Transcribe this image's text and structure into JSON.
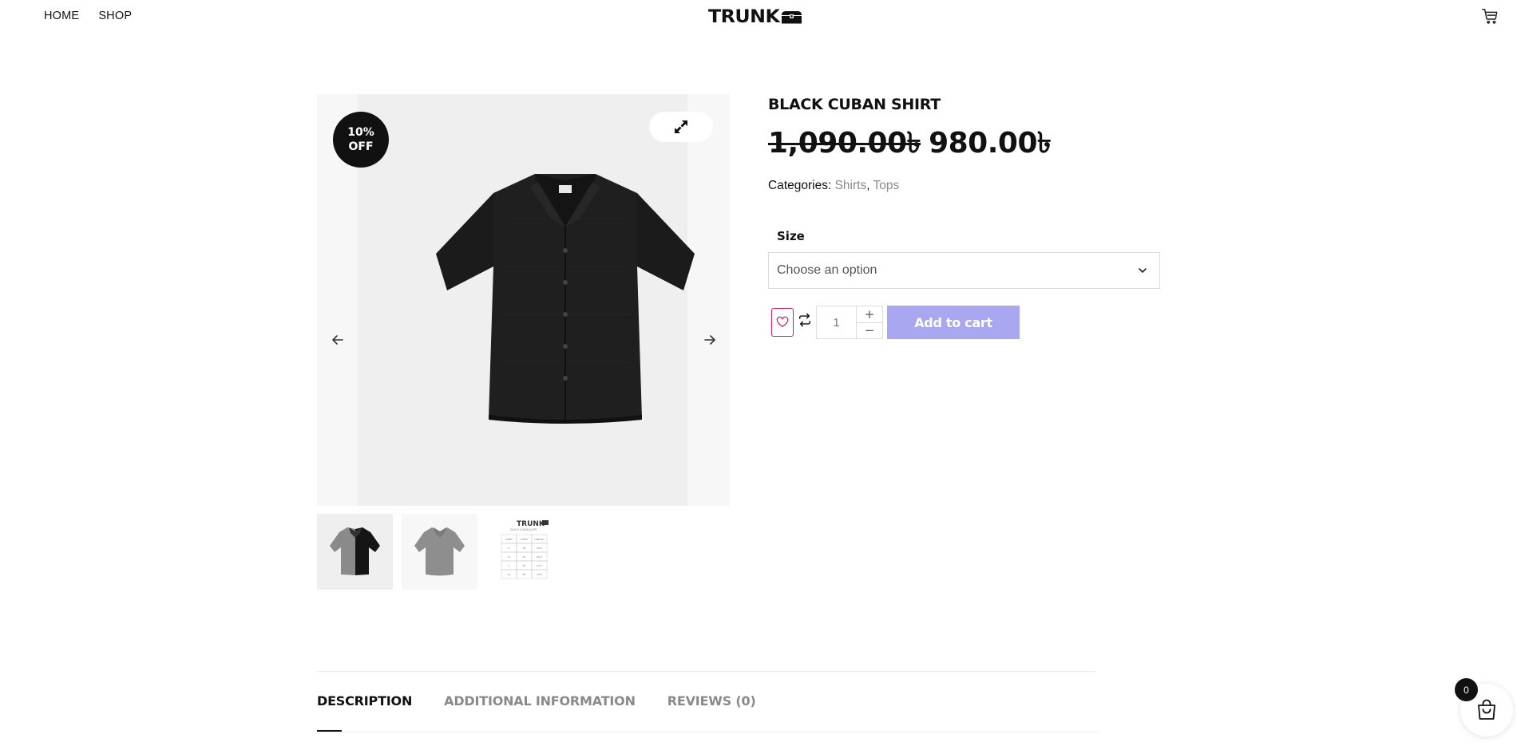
{
  "header": {
    "nav": [
      {
        "label": "HOME"
      },
      {
        "label": "SHOP"
      }
    ],
    "logo_text": "TRUNK",
    "cart_icon": "cart-icon"
  },
  "gallery": {
    "sale_badge_line1": "10%",
    "sale_badge_line2": "OFF",
    "zoom_icon": "expand-icon",
    "prev_icon": "arrow-left-icon",
    "next_icon": "arrow-right-icon",
    "thumbnails": [
      "shirt-two-tone",
      "shirt-grey",
      "size-chart"
    ],
    "size_chart_title": "TRUNK",
    "size_chart_subtitle": "BLACK CUBAN SHIRT",
    "size_chart_headers": [
      "SIZES",
      "CHEST",
      "LENGTH"
    ],
    "size_chart_rows": [
      [
        "S",
        "39",
        "26.5"
      ],
      [
        "M",
        "41",
        "26.5"
      ],
      [
        "L",
        "43",
        "27.5"
      ],
      [
        "XL",
        "45",
        "28.5"
      ]
    ]
  },
  "product": {
    "title": "BLACK CUBAN SHIRT",
    "regular_price": "1,090.00৳",
    "sale_price": "980.00৳",
    "categories_label": "Categories:",
    "categories": [
      "Shirts",
      "Tops"
    ],
    "separator": ",",
    "size_label": "Size",
    "size_placeholder": "Choose an option",
    "quantity": "1",
    "qty_plus": "+",
    "qty_minus": "−",
    "add_to_cart_label": "Add to cart",
    "add_to_cart_color": "#a9a7ef",
    "wishlist_color": "#d2185f"
  },
  "tabs": [
    {
      "label": "DESCRIPTION",
      "active": true
    },
    {
      "label": "ADDITIONAL INFORMATION",
      "active": false
    },
    {
      "label": "REVIEWS (0)",
      "active": false
    }
  ],
  "floating_cart": {
    "count": "0",
    "icon": "shopping-bag-icon"
  }
}
